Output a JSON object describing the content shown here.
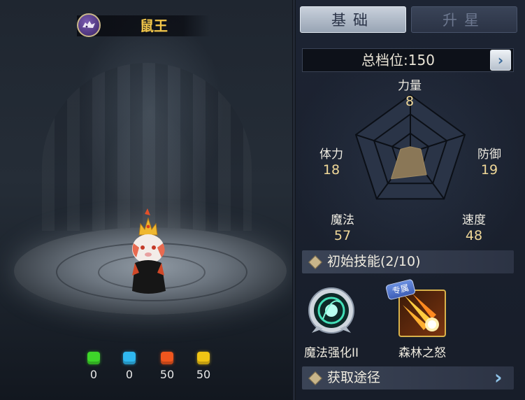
{
  "creature": {
    "name": "鼠王",
    "emblem": "beast-emblem-icon"
  },
  "gems": [
    {
      "color": "#3ed62a",
      "value": "0",
      "icon": "green-gem-icon"
    },
    {
      "color": "#2fb8f0",
      "value": "0",
      "icon": "blue-gem-icon"
    },
    {
      "color": "#f0561e",
      "value": "50",
      "icon": "red-gem-icon"
    },
    {
      "color": "#f0c414",
      "value": "50",
      "icon": "yellow-gem-icon"
    }
  ],
  "tabs": {
    "basic": "基础",
    "star": "升星"
  },
  "total": {
    "text": "总档位:150"
  },
  "stats": {
    "strength": {
      "name": "力量",
      "value": "8"
    },
    "defense": {
      "name": "防御",
      "value": "19"
    },
    "speed": {
      "name": "速度",
      "value": "48"
    },
    "magic": {
      "name": "魔法",
      "value": "57"
    },
    "stamina": {
      "name": "体力",
      "value": "18"
    }
  },
  "chart_data": {
    "type": "radar",
    "axes": [
      "力量",
      "防御",
      "速度",
      "魔法",
      "体力"
    ],
    "values": [
      8,
      19,
      48,
      57,
      18
    ],
    "fill_color": "#8a7757",
    "grid_color": "#0b0f16"
  },
  "skills": {
    "title": "初始技能(2/10)",
    "items": [
      {
        "name": "魔法强化II",
        "icon": "magic-boost-icon"
      },
      {
        "name": "森林之怒",
        "icon": "forest-fury-icon",
        "badge": "专属"
      }
    ]
  },
  "obtain": {
    "title": "获取途径"
  }
}
